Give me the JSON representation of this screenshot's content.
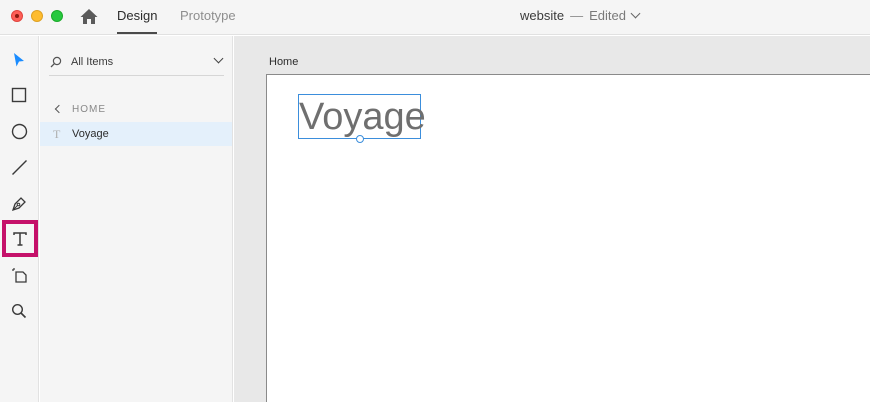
{
  "window": {
    "tabs": [
      {
        "label": "Design",
        "active": true
      },
      {
        "label": "Prototype",
        "active": false
      }
    ],
    "doc_name": "website",
    "separator": "—",
    "doc_status": "Edited"
  },
  "toolbar": {
    "tools": [
      {
        "name": "select",
        "icon": "arrow-icon"
      },
      {
        "name": "rectangle",
        "icon": "rectangle-icon"
      },
      {
        "name": "ellipse",
        "icon": "ellipse-icon"
      },
      {
        "name": "line",
        "icon": "line-icon"
      },
      {
        "name": "pen",
        "icon": "pen-icon"
      },
      {
        "name": "text",
        "icon": "text-icon",
        "highlighted": true
      },
      {
        "name": "artboard",
        "icon": "artboard-icon"
      },
      {
        "name": "zoom",
        "icon": "magnifier-icon"
      }
    ],
    "highlight_color": "#c5116a",
    "select_color": "#1a8cff"
  },
  "layers": {
    "filter_label": "All Items",
    "breadcrumb": "HOME",
    "items": [
      {
        "label": "Voyage",
        "icon": "text-layer-icon",
        "selected": true
      }
    ]
  },
  "canvas": {
    "artboard_title": "Home",
    "text_object": "Voyage",
    "selection_color": "#3b8edc"
  }
}
